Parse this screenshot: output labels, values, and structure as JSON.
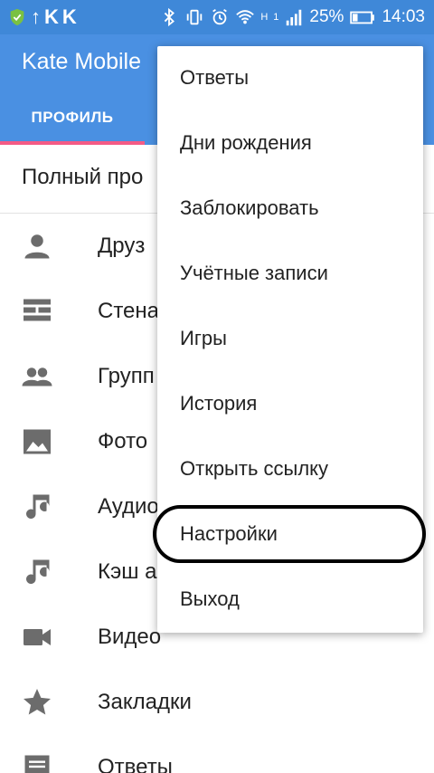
{
  "status_bar": {
    "left_glyphs": [
      "↑",
      "K",
      "K"
    ],
    "network": "H",
    "sim": "1",
    "battery": "25%",
    "time": "14:03"
  },
  "app_bar": {
    "title": "Kate Mobile",
    "tab": "ПРОФИЛЬ",
    "accent": "#4a90e2",
    "indicator_color": "#f45b86"
  },
  "profile": {
    "title": "Полный про"
  },
  "list": [
    {
      "label": "Друз",
      "icon": "person-icon"
    },
    {
      "label": "Стена",
      "icon": "wall-icon"
    },
    {
      "label": "Групп",
      "icon": "group-icon"
    },
    {
      "label": "Фото",
      "icon": "photo-icon"
    },
    {
      "label": "Аудио",
      "icon": "music-icon"
    },
    {
      "label": "Кэш а",
      "icon": "music-icon"
    },
    {
      "label": "Видео",
      "icon": "video-icon"
    },
    {
      "label": "Закладки",
      "icon": "star-icon"
    },
    {
      "label": "Ответы",
      "icon": "comment-icon"
    }
  ],
  "menu": [
    {
      "label": "Ответы"
    },
    {
      "label": "Дни рождения"
    },
    {
      "label": "Заблокировать"
    },
    {
      "label": "Учётные записи"
    },
    {
      "label": "Игры"
    },
    {
      "label": "История"
    },
    {
      "label": "Открыть ссылку"
    },
    {
      "label": "Настройки"
    },
    {
      "label": "Выход"
    }
  ]
}
